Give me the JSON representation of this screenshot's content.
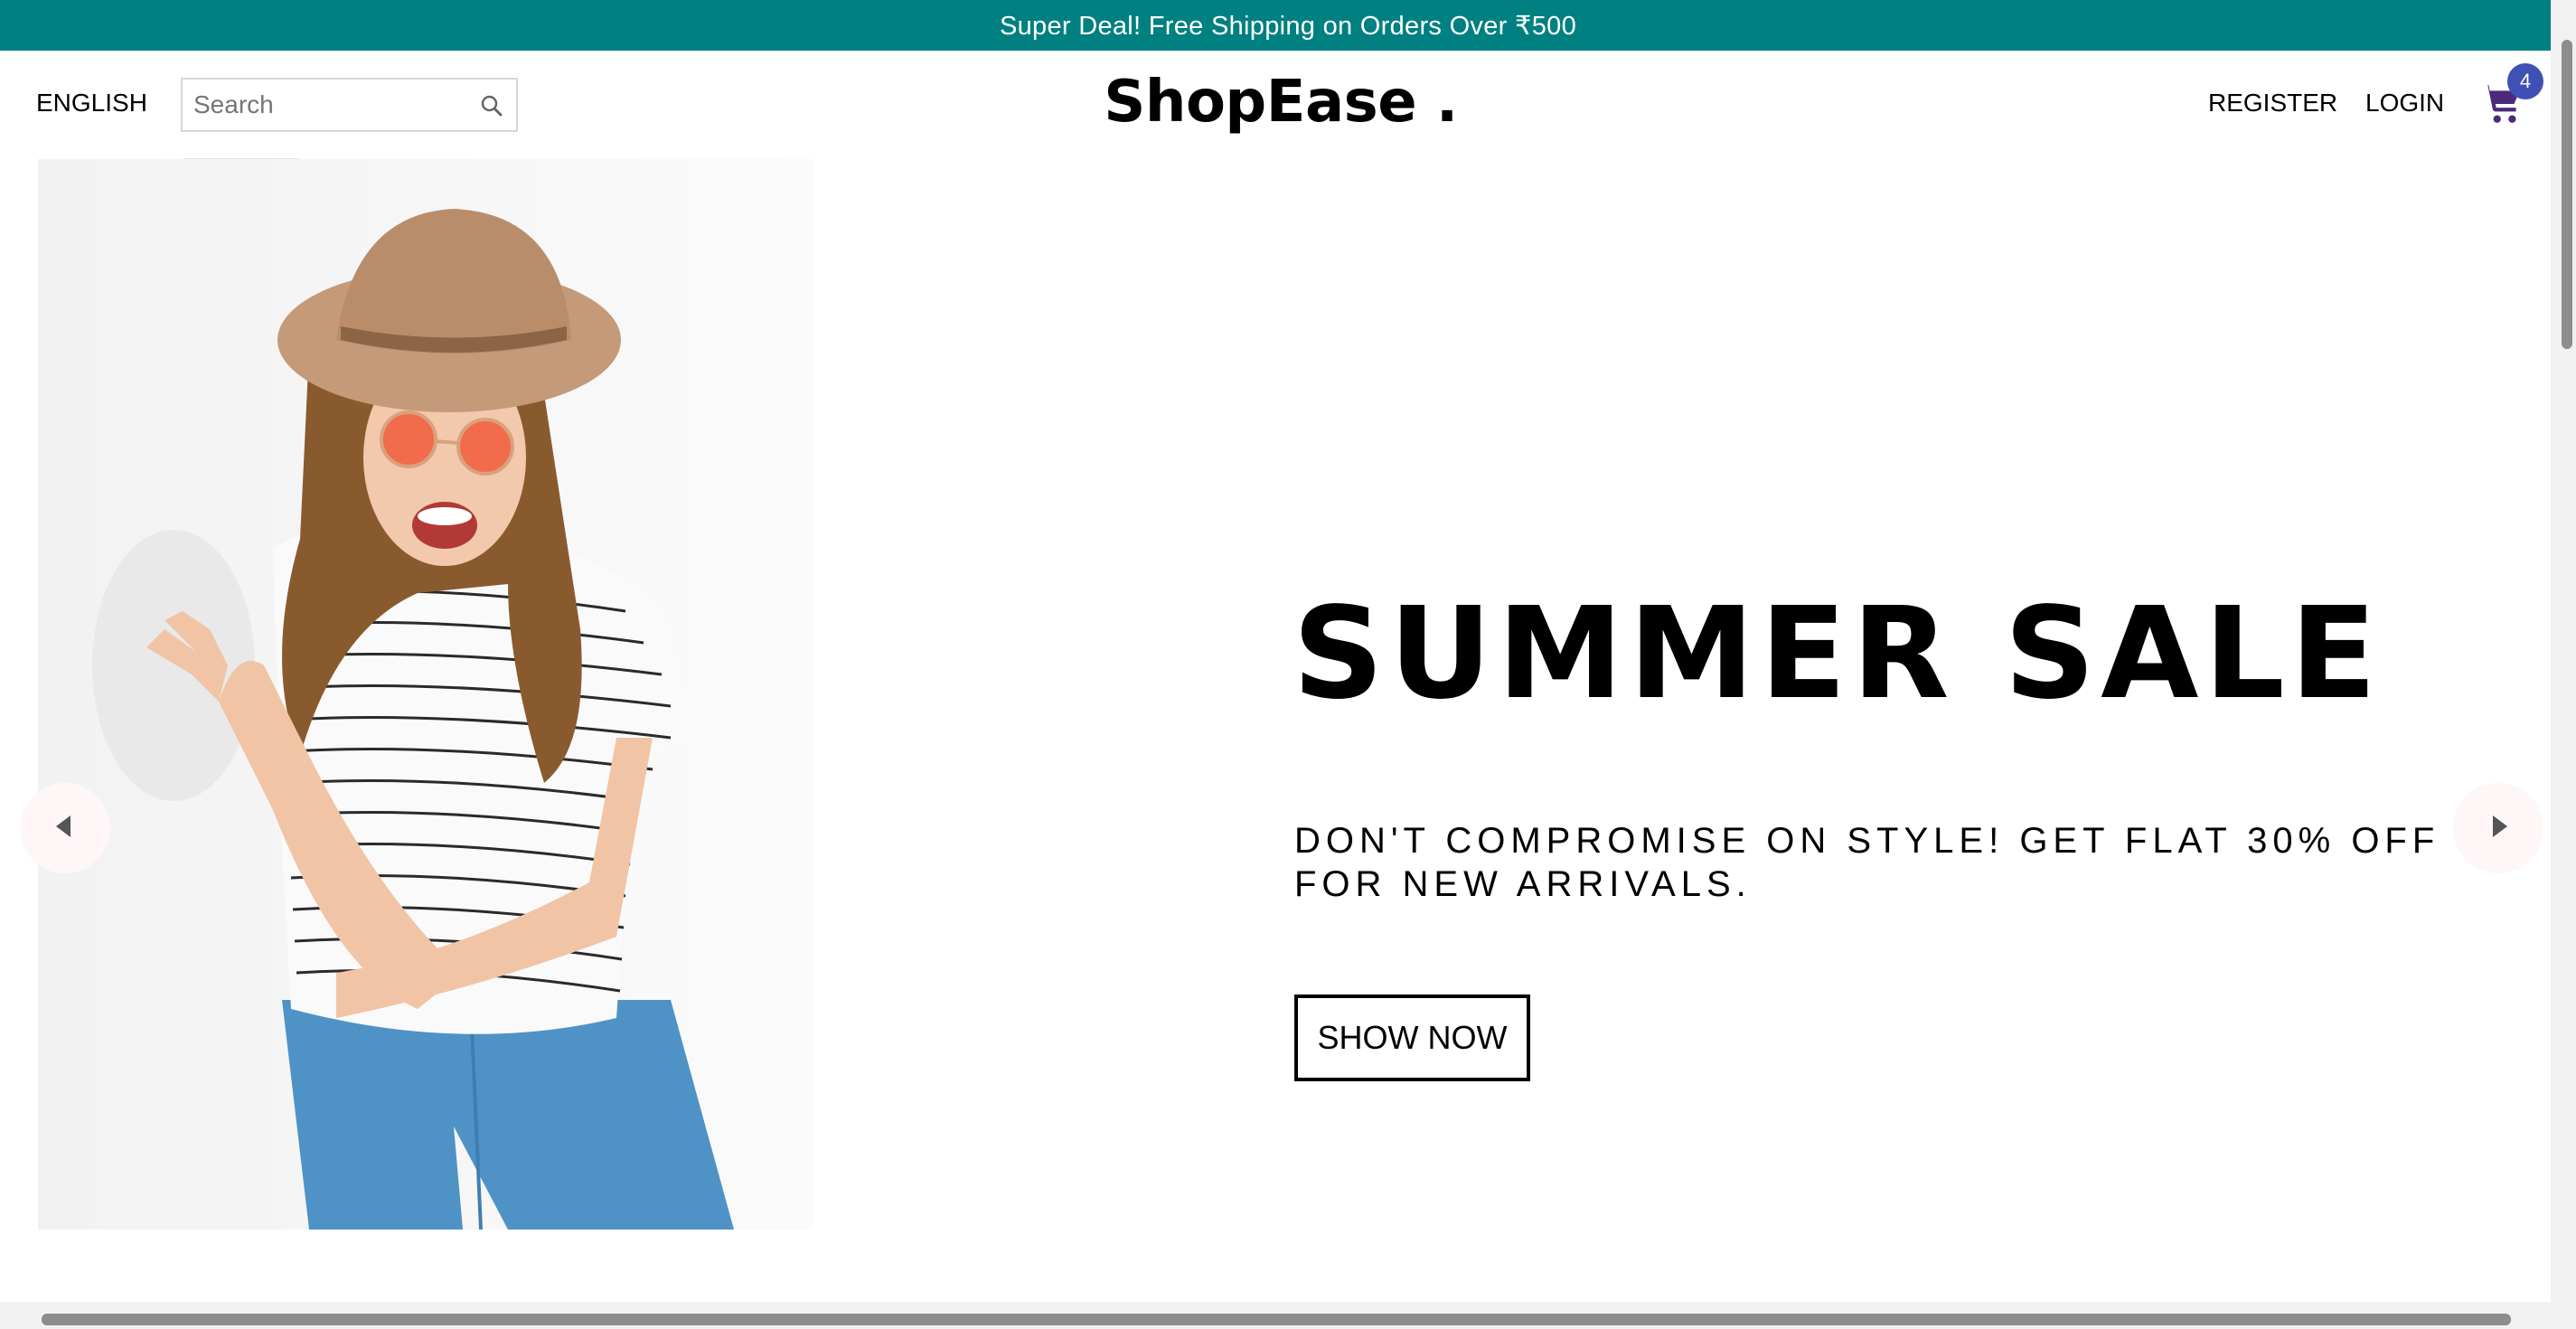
{
  "announcement": {
    "text": "Super Deal! Free Shipping on Orders Over ₹500"
  },
  "navbar": {
    "language": "ENGLISH",
    "search": {
      "placeholder": "Search",
      "value": ""
    },
    "logo": "ShopEase .",
    "register": "REGISTER",
    "login": "LOGIN",
    "cart_count": "4"
  },
  "hero": {
    "title": "SUMMER SALE",
    "description": "DON'T COMPROMISE ON STYLE! GET FLAT 30% OFF FOR NEW ARRIVALS.",
    "button": "SHOW NOW",
    "image_alt": "woman in hat and sunglasses"
  },
  "colors": {
    "announcement_bg": "#008080",
    "badge_bg": "#3f51b5",
    "cart_icon": "#4b2a7b"
  },
  "icons": {
    "search": "search-icon",
    "cart": "cart-icon",
    "left": "arrow-left-icon",
    "right": "arrow-right-icon"
  }
}
